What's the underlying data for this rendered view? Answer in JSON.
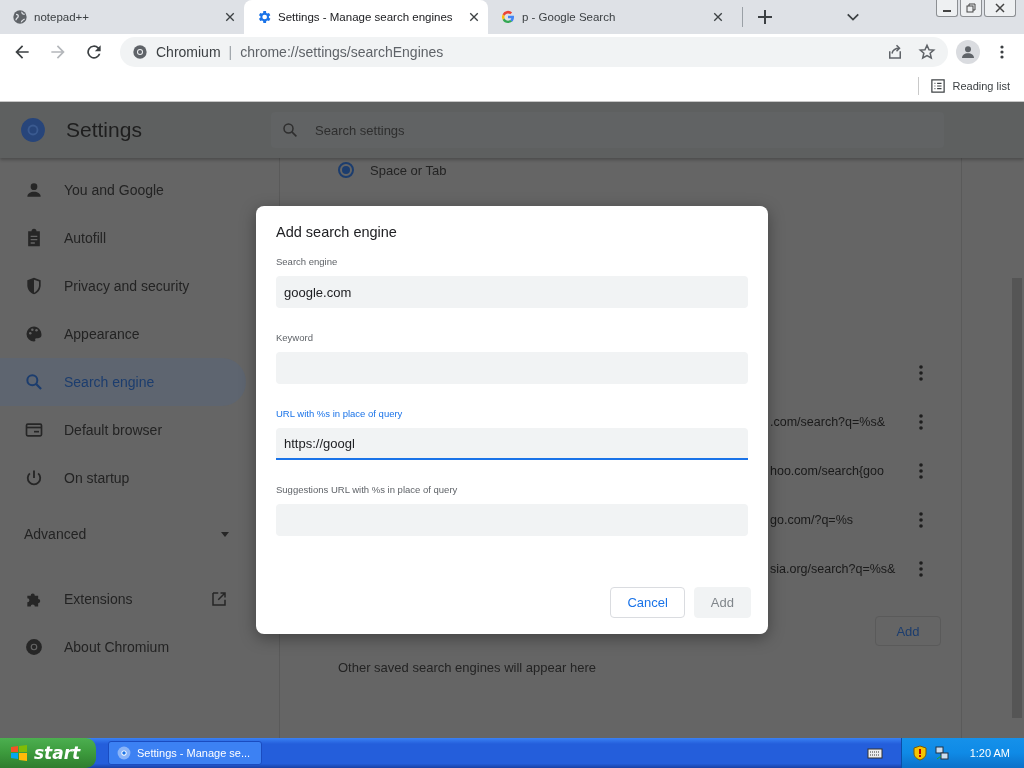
{
  "browser": {
    "tabs": [
      {
        "title": "notepad++",
        "selected": false
      },
      {
        "title": "Settings - Manage search engines",
        "selected": true
      },
      {
        "title": "p - Google Search",
        "selected": false
      }
    ],
    "nav": [
      {
        "kind": "back",
        "disabled": false
      },
      {
        "kind": "forward",
        "disabled": true
      },
      {
        "kind": "reload",
        "disabled": false
      }
    ],
    "omnibox": {
      "site": "Chromium",
      "separator": "|",
      "url": "chrome://settings/searchEngines"
    },
    "reading_list": "Reading list"
  },
  "settings": {
    "title": "Settings",
    "search_placeholder": "Search settings",
    "sidebar": {
      "items": [
        {
          "label": "You and Google",
          "selected": false
        },
        {
          "label": "Autofill",
          "selected": false
        },
        {
          "label": "Privacy and security",
          "selected": false
        },
        {
          "label": "Appearance",
          "selected": false
        },
        {
          "label": "Search engine",
          "selected": true
        },
        {
          "label": "Default browser",
          "selected": false
        },
        {
          "label": "On startup",
          "selected": false
        }
      ],
      "advanced": "Advanced",
      "links": [
        {
          "label": "Extensions",
          "external": true
        },
        {
          "label": "About Chromium",
          "external": false
        }
      ]
    },
    "content": {
      "radio": {
        "label": "Space or Tab",
        "selected": true
      },
      "engine_rows": [
        {},
        {
          "url": ".com/search?q=%s&"
        },
        {
          "url": "hoo.com/search{goo"
        },
        {
          "url": "go.com/?q=%s"
        },
        {
          "url": "sia.org/search?q=%s&"
        }
      ],
      "add_button": "Add",
      "note": "Other saved search engines will appear here"
    }
  },
  "dialog": {
    "title": "Add search engine",
    "fields": [
      {
        "label": "Search engine",
        "value": "google.com",
        "focused": false
      },
      {
        "label": "Keyword",
        "focused": false
      },
      {
        "label": "URL with %s in place of query",
        "value": "https://googl",
        "focused": true
      },
      {
        "label": "Suggestions URL with %s in place of query",
        "focused": false
      }
    ],
    "buttons": [
      {
        "label": "Cancel",
        "kind": "secondary",
        "disabled": false
      },
      {
        "label": "Add",
        "kind": "primary",
        "disabled": true
      }
    ]
  },
  "taskbar": {
    "start": "start",
    "tasks": [
      {
        "title": "Settings - Manage se...",
        "selected": false
      }
    ],
    "clock": "1:20 AM"
  }
}
